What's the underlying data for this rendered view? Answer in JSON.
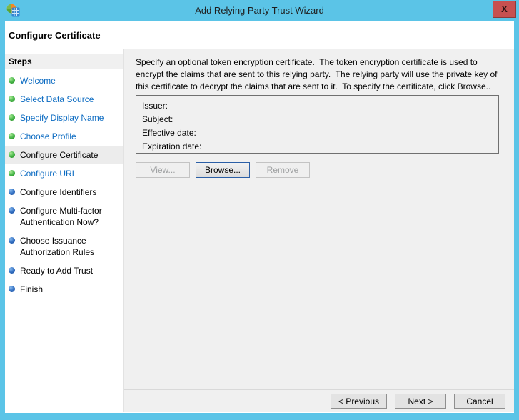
{
  "window": {
    "title": "Add Relying Party Trust Wizard",
    "close_label": "X",
    "icon": "adfs-wizard-icon"
  },
  "header": {
    "title": "Configure Certificate"
  },
  "sidebar": {
    "title": "Steps",
    "items": [
      {
        "label": "Welcome",
        "state": "visited",
        "bullet": "green"
      },
      {
        "label": "Select Data Source",
        "state": "visited",
        "bullet": "green"
      },
      {
        "label": "Specify Display Name",
        "state": "visited",
        "bullet": "green"
      },
      {
        "label": "Choose Profile",
        "state": "visited",
        "bullet": "green"
      },
      {
        "label": "Configure Certificate",
        "state": "current",
        "bullet": "green"
      },
      {
        "label": "Configure URL",
        "state": "visited",
        "bullet": "green"
      },
      {
        "label": "Configure Identifiers",
        "state": "upcoming",
        "bullet": "blue"
      },
      {
        "label": "Configure Multi-factor Authentication Now?",
        "state": "upcoming",
        "bullet": "blue"
      },
      {
        "label": "Choose Issuance Authorization Rules",
        "state": "upcoming",
        "bullet": "blue"
      },
      {
        "label": "Ready to Add Trust",
        "state": "upcoming",
        "bullet": "blue"
      },
      {
        "label": "Finish",
        "state": "upcoming",
        "bullet": "blue"
      }
    ]
  },
  "content": {
    "description": "Specify an optional token encryption certificate.  The token encryption certificate is used to encrypt the claims that are sent to this relying party.  The relying party will use the private key of this certificate to decrypt the claims that are sent to it.  To specify the certificate, click Browse..",
    "certificate_fields": [
      {
        "label": "Issuer:",
        "value": ""
      },
      {
        "label": "Subject:",
        "value": ""
      },
      {
        "label": "Effective date:",
        "value": ""
      },
      {
        "label": "Expiration date:",
        "value": ""
      }
    ],
    "buttons": {
      "view": "View...",
      "browse": "Browse...",
      "remove": "Remove"
    }
  },
  "footer": {
    "previous": "< Previous",
    "next": "Next >",
    "cancel": "Cancel"
  },
  "colors": {
    "titlebar": "#5bc4e7",
    "close_button": "#c75050",
    "link": "#0b6bc2",
    "bullet_green": "#2f9e2f",
    "bullet_blue": "#1c55a8",
    "content_bg": "#f0f0f0",
    "default_button_border": "#2b5fa6"
  }
}
